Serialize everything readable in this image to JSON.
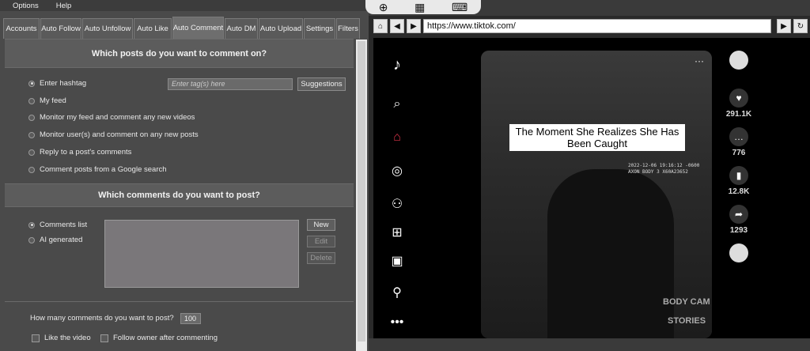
{
  "menu": [
    "Options",
    "Help"
  ],
  "tabs": [
    {
      "label": "Accounts"
    },
    {
      "label": "Auto Follow"
    },
    {
      "label": "Auto Unfollow"
    },
    {
      "label": "Auto Like"
    },
    {
      "label": "Auto Comment",
      "active": true
    },
    {
      "label": "Auto DM"
    },
    {
      "label": "Auto Upload"
    },
    {
      "label": "Settings"
    },
    {
      "label": "Filters"
    }
  ],
  "section1": {
    "title": "Which posts do you want to comment on?",
    "options": [
      "Enter hashtag",
      "My feed",
      "Monitor my feed and comment any new videos",
      "Monitor user(s) and comment on any new posts",
      "Reply to a post's comments",
      "Comment posts from a Google search"
    ],
    "hashtag_placeholder": "Enter tag(s) here",
    "suggestions_label": "Suggestions"
  },
  "section2": {
    "title": "Which comments do you want to post?",
    "options": [
      "Comments list",
      "AI generated"
    ],
    "buttons": {
      "new": "New",
      "edit": "Edit",
      "delete": "Delete"
    }
  },
  "count": {
    "label": "How many comments do you want to post?",
    "value": "100"
  },
  "checks": {
    "like": "Like the video",
    "follow": "Follow owner after commenting"
  },
  "browser": {
    "url": "https://www.tiktok.com/",
    "caption": "The Moment She Realizes She Has Been Caught",
    "timestamp": "2022-12-06 19:16:12 -0600",
    "device": "AXON BODY 3 X60A23652",
    "watermark1": "BODY CAM",
    "watermark2": "STORIES",
    "likes": "291.1K",
    "comments": "776",
    "saves": "12.8K",
    "shares": "1293",
    "more": "···"
  }
}
